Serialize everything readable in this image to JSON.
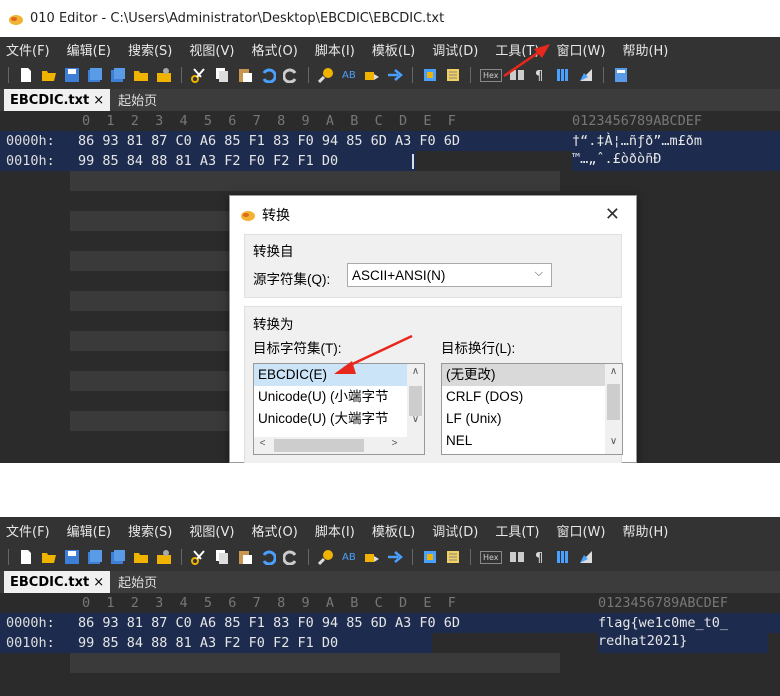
{
  "shot1": {
    "window_title": "010 Editor - C:\\Users\\Administrator\\Desktop\\EBCDIC\\EBCDIC.txt",
    "menu": [
      "文件(F)",
      "编辑(E)",
      "搜索(S)",
      "视图(V)",
      "格式(O)",
      "脚本(I)",
      "模板(L)",
      "调试(D)",
      "工具(T)",
      "窗口(W)",
      "帮助(H)"
    ],
    "tabs": {
      "active": "EBCDIC.txt",
      "close": "×",
      "inactive": "起始页"
    },
    "hex_header": "0  1  2  3  4  5  6  7  8  9  A  B  C  D  E  F",
    "ascii_header": "0123456789ABCDEF",
    "rows": [
      {
        "addr": "0000h:",
        "bytes": "86 93 81 87 C0 A6 85 F1 83 F0 94 85 6D A3 F0 6D",
        "ascii": "†“.‡À¦…ñƒð”…m£ðm"
      },
      {
        "addr": "0010h:",
        "bytes": "99 85 84 88 81 A3 F2 F0 F2 F1 D0",
        "ascii": "™…„ˆ.£òðòñÐ"
      }
    ],
    "dialog": {
      "title": "转换",
      "close": "✕",
      "from_group": "转换自",
      "source_label": "源字符集(Q):",
      "source_value": "ASCII+ANSI(N)",
      "to_group": "转换为",
      "target_charset_label": "目标字符集(T):",
      "target_newline_label": "目标换行(L):",
      "charsets": [
        "EBCDIC(E)",
        "Unicode(U) (小端字节",
        "Unicode(U) (大端字节"
      ],
      "newlines": [
        "(无更改)",
        "CRLF (DOS)",
        "LF (Unix)",
        "NEL"
      ]
    },
    "colors": {
      "bg": "#2b2b2b",
      "selection": "#1d2b4e",
      "arrow": "#e8281c"
    }
  },
  "shot2": {
    "menu": [
      "文件(F)",
      "编辑(E)",
      "搜索(S)",
      "视图(V)",
      "格式(O)",
      "脚本(I)",
      "模板(L)",
      "调试(D)",
      "工具(T)",
      "窗口(W)",
      "帮助(H)"
    ],
    "tabs": {
      "active": "EBCDIC.txt",
      "close": "×",
      "inactive": "起始页"
    },
    "hex_header": "0  1  2  3  4  5  6  7  8  9  A  B  C  D  E  F",
    "ascii_header": "0123456789ABCDEF",
    "rows": [
      {
        "addr": "0000h:",
        "bytes": "86 93 81 87 C0 A6 85 F1 83 F0 94 85 6D A3 F0 6D",
        "ascii": "flag{we1c0me_t0_"
      },
      {
        "addr": "0010h:",
        "bytes": "99 85 84 88 81 A3 F2 F0 F2 F1 D0",
        "ascii": "redhat2021}"
      }
    ]
  }
}
